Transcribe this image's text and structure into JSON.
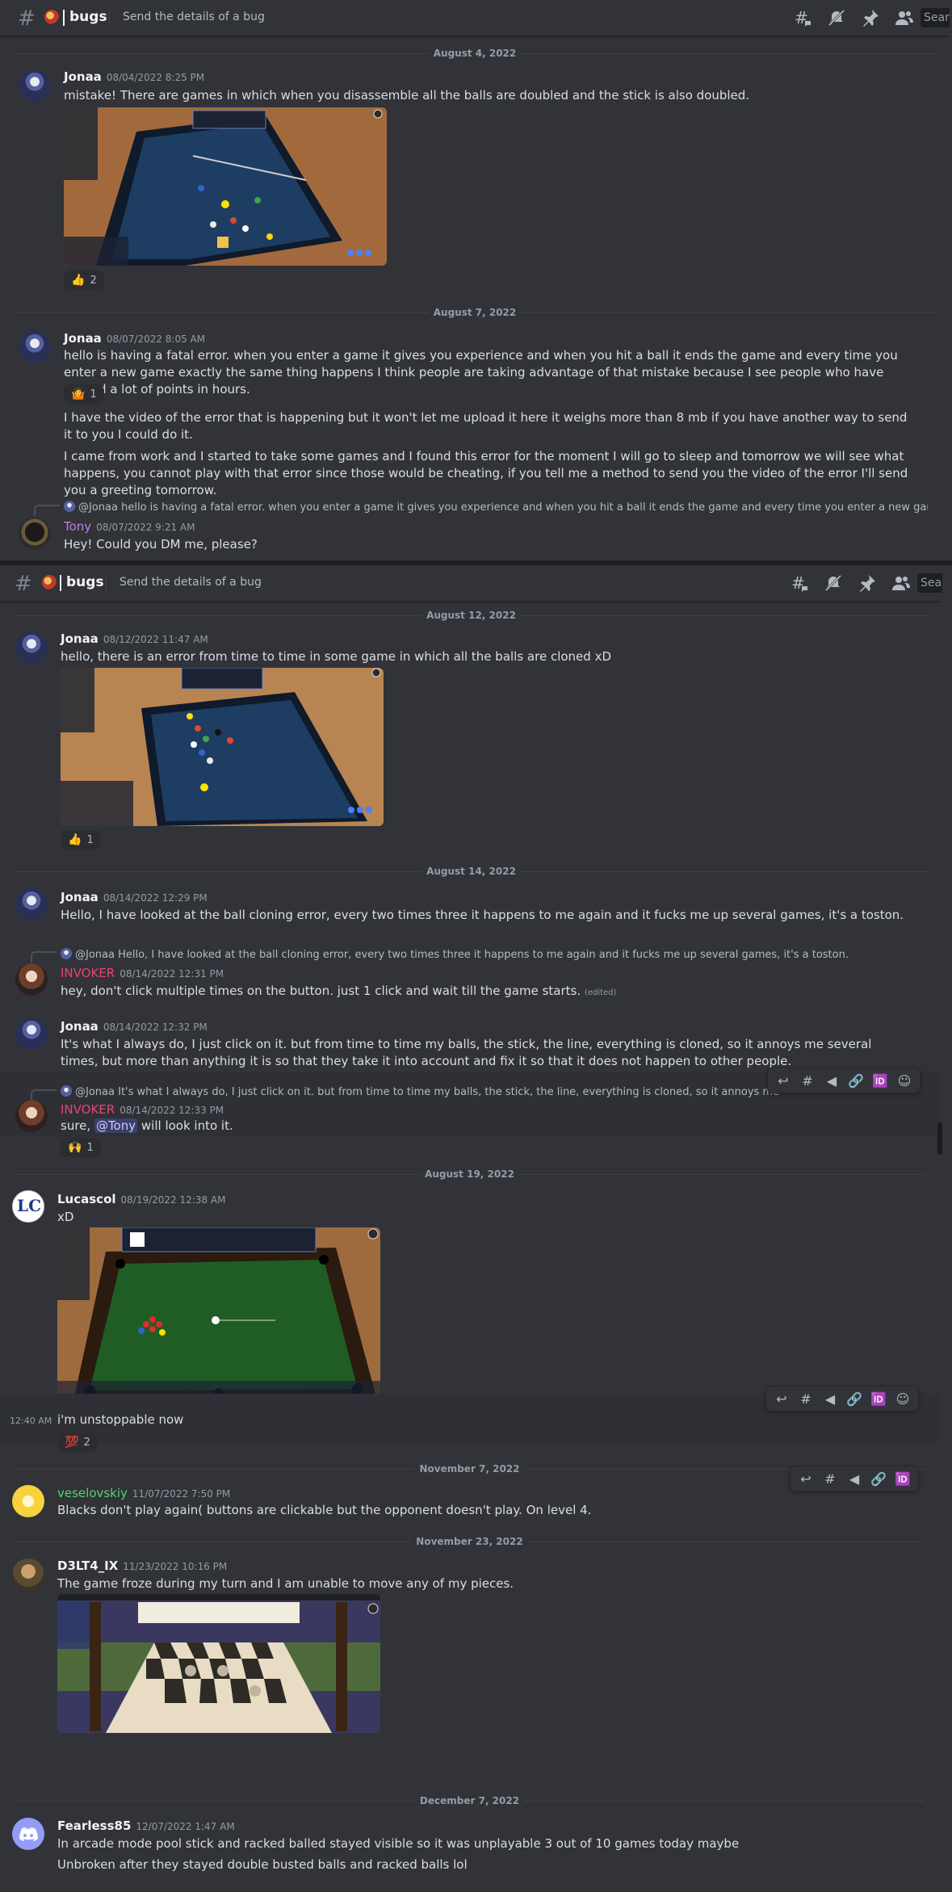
{
  "channel": {
    "name": "bugs",
    "topic": "Send the details of a bug",
    "search_label": "Search"
  },
  "panel1": {
    "separators": [
      "August 4, 2022",
      "August 7, 2022"
    ],
    "messages": [
      {
        "author": "Jonaa",
        "timestamp": "08/04/2022 8:25 PM",
        "text": "mistake! There are games in which when you disassemble all the balls are doubled and the stick is also doubled.",
        "reaction": {
          "emoji": "👍",
          "count": "2"
        }
      },
      {
        "author": "Jonaa",
        "timestamp": "08/07/2022 8:05 AM",
        "text": "hello is having a fatal error. when you enter a game it gives you experience and when you hit a ball it ends the game and every time you enter a new game exactly the same thing happens I think people are taking advantage of that mistake because I see people who have earned a lot of points in hours.",
        "reaction": {
          "emoji": "🤷",
          "count": "1"
        },
        "text2": "I have the video of the error that is happening but it won't let me upload it here it weighs more than 8 mb if you have another way to send it to you I could do it.",
        "text3": "I came from work and I started to take some games and I found this error for the moment I will go to sleep and tomorrow we will see what happens, you cannot play with that error since those would be cheating, if you tell me a method to send you the video of the error I'll send you a greeting tomorrow."
      },
      {
        "reply_to": "@Jonaa",
        "reply_text": "hello is having a fatal error. when you enter a game it gives you experience and when you hit a ball it ends the game and every time you enter a new game exactly the same thing happens",
        "author": "Tony",
        "timestamp": "08/07/2022 9:21 AM",
        "text": "Hey! Could you DM me, please?"
      }
    ]
  },
  "panel2": {
    "separators": [
      "August 12, 2022",
      "August 14, 2022"
    ],
    "messages": [
      {
        "author": "Jonaa",
        "timestamp": "08/12/2022 11:47 AM",
        "text": "hello, there is an error from time to time in some game in which all the balls are cloned xD",
        "reaction": {
          "emoji": "👍",
          "count": "1"
        }
      },
      {
        "author": "Jonaa",
        "timestamp": "08/14/2022 12:29 PM",
        "text": "Hello, I have looked at the ball cloning error, every two times three it happens to me again and it fucks me up several games, it's a toston."
      },
      {
        "reply_to": "@Jonaa",
        "reply_text": "Hello, I have looked at the ball cloning error, every two times three it happens to me again and it fucks me up several games, it's a toston.",
        "author": "INVOKER",
        "timestamp": "08/14/2022 12:31 PM",
        "text": "hey, don't click multiple times on the button. just 1 click and wait till the game starts.",
        "edited": "(edited)"
      },
      {
        "author": "Jonaa",
        "timestamp": "08/14/2022 12:32 PM",
        "text": "It's what I always do, I just click on it. but from time to time my balls, the stick, the line, everything is cloned, so it annoys me several times, but more than anything it is so that they take it into account and fix it so that it does not happen to other people."
      },
      {
        "reply_to": "@Jonaa",
        "reply_text": "It's what I always do, I just click on it. but from time to time my balls, the stick, the line, everything is cloned, so it annoys me several times",
        "author": "INVOKER",
        "timestamp": "08/14/2022 12:33 PM",
        "text_before": "sure,",
        "mention": "@Tony",
        "text_after": "will look into it.",
        "reaction": {
          "emoji": "🙌",
          "count": "1"
        }
      }
    ]
  },
  "panel3": {
    "separators": [
      "August 19, 2022",
      "November 7, 2022",
      "November 23, 2022",
      "December 7, 2022"
    ],
    "messages": [
      {
        "author": "Lucascol",
        "timestamp": "08/19/2022 12:38 AM",
        "text": "xD"
      },
      {
        "cozy_time": "12:40 AM",
        "text": "i'm unstoppable now",
        "reaction": {
          "emoji": "💯",
          "count": "2"
        }
      },
      {
        "author": "veselovskiy",
        "timestamp": "11/07/2022 7:50 PM",
        "text": "Blacks don't play again( buttons are clickable but the opponent doesn't play. On level 4."
      },
      {
        "author": "D3LT4_IX",
        "timestamp": "11/23/2022 10:16 PM",
        "text": "The game froze during my turn and I am unable to move any of my pieces."
      },
      {
        "author": "Fearless85",
        "timestamp": "12/07/2022 1:47 AM",
        "text": "In arcade mode pool stick and racked balled stayed visible so it was unplayable 3 out of 10 games today maybe",
        "text2": "Unbroken after they stayed double busted balls and racked balls lol"
      }
    ]
  },
  "colors": {
    "tony": "#c27ce8",
    "invoker": "#e9436f",
    "veselovskiy": "#57d26a",
    "blurple": "#5865f2"
  },
  "icons": [
    "threads-icon",
    "mute-icon",
    "pin-icon",
    "members-icon",
    "reply-icon",
    "thread-icon",
    "forward-icon",
    "link-icon",
    "id-icon",
    "emoji-icon"
  ]
}
